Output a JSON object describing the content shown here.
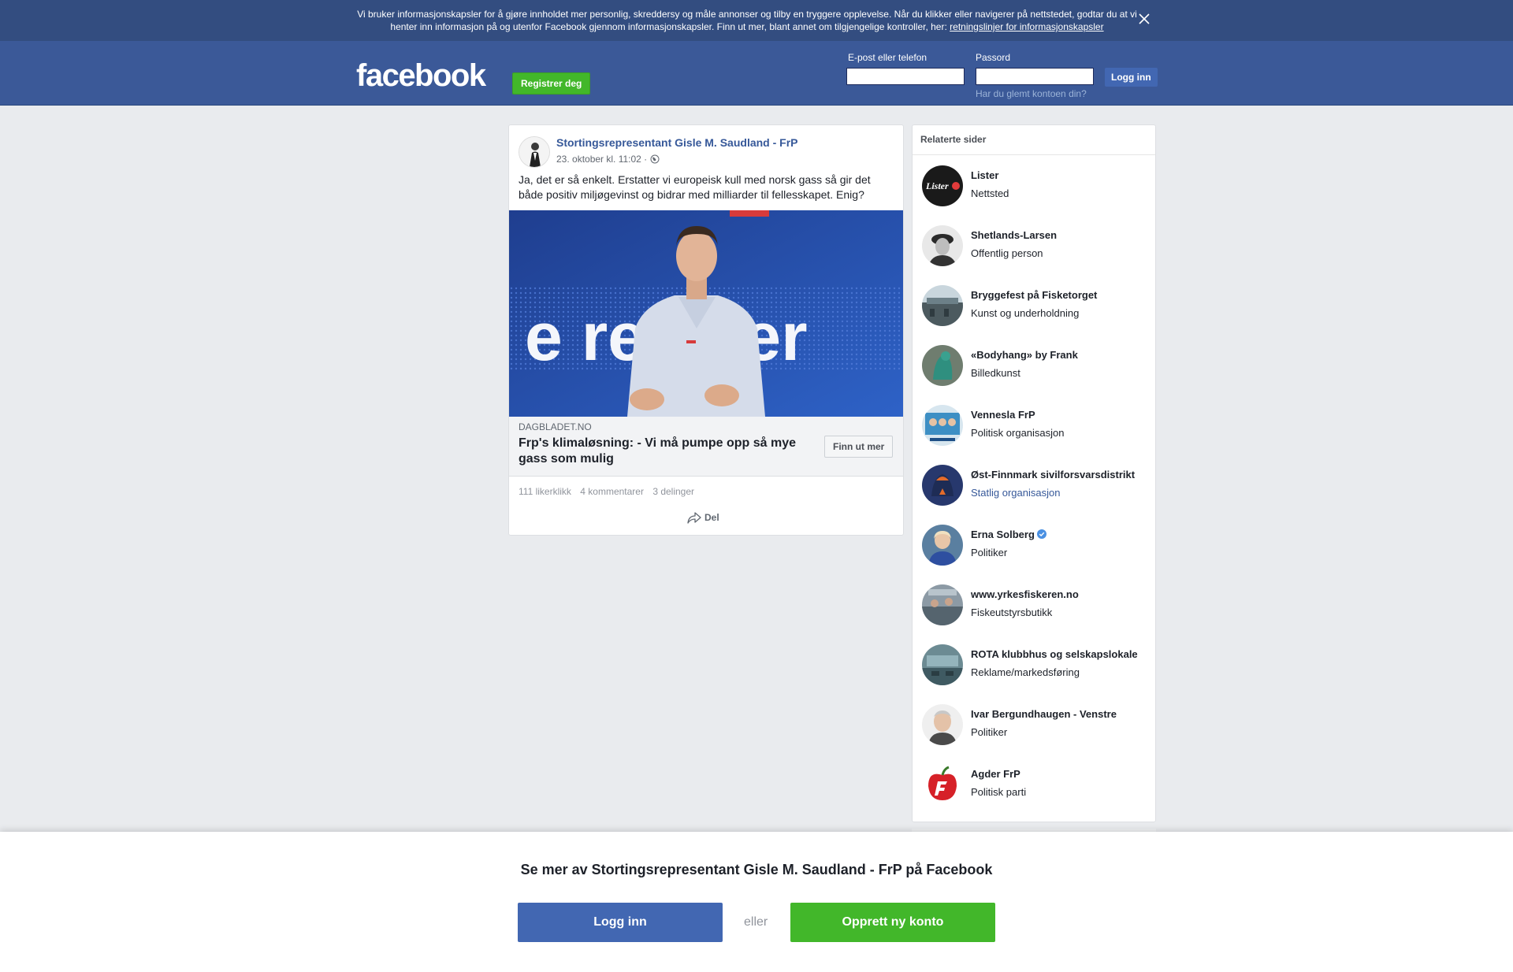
{
  "cookie_banner": {
    "text": "Vi bruker informasjonskapsler for å gjøre innholdet mer personlig, skreddersy og måle annonser og tilby en tryggere opplevelse. Når du klikker eller navigerer på nettstedet, godtar du at vi henter inn informasjon på og utenfor Facebook gjennom informasjonskapsler. Finn ut mer, blant annet om tilgjengelige kontroller, her: ",
    "link": "retningslinjer for informasjonskapsler",
    "close_icon": "close-icon"
  },
  "header": {
    "logo": "facebook",
    "register_label": "Registrer deg",
    "email_label": "E-post eller telefon",
    "password_label": "Passord",
    "login_label": "Logg inn",
    "forgot": "Har du glemt kontoen din?"
  },
  "post": {
    "author": "Stortingsrepresentant Gisle M. Saudland - FrP",
    "date": "23. oktober kl. 11:02 ·",
    "text": "Ja, det er så enkelt. Erstatter vi europeisk kull med norsk gass så gir det både positiv miljøgevinst og bidrar med milliarder til fellesskapet. Enig?",
    "image_text": "e re hver",
    "link_domain": "DAGBLADET.NO",
    "link_title": "Frp's klimaløsning: - Vi må pumpe opp så mye gass som mulig",
    "link_button": "Finn ut mer",
    "likes": "111 likerklikk",
    "comments": "4 kommentarer",
    "shares": "3 delinger",
    "share_label": "Del"
  },
  "related": {
    "title": "Relaterte sider",
    "items": [
      {
        "name": "Lister",
        "category": "Nettsted",
        "avatar_text": "Lister"
      },
      {
        "name": "Shetlands-Larsen",
        "category": "Offentlig person"
      },
      {
        "name": "Bryggefest på Fisketorget",
        "category": "Kunst og underholdning"
      },
      {
        "name": "«Bodyhang» by Frank",
        "category": "Billedkunst"
      },
      {
        "name": "Vennesla FrP",
        "category": "Politisk organisasjon"
      },
      {
        "name": "Øst-Finnmark sivilforsvarsdistrikt",
        "category": "Statlig organisasjon"
      },
      {
        "name": "Erna Solberg",
        "category": "Politiker"
      },
      {
        "name": "www.yrkesfiskeren.no",
        "category": "Fiskeutstyrsbutikk"
      },
      {
        "name": "ROTA klubbhus og selskapslokale",
        "category": "Reklame/markedsføring"
      },
      {
        "name": "Ivar Bergundhaugen - Venstre",
        "category": "Politiker"
      },
      {
        "name": "Agder FrP",
        "category": "Politisk parti"
      }
    ]
  },
  "bottom": {
    "title": "Se mer av Stortingsrepresentant Gisle M. Saudland - FrP på Facebook",
    "login_label": "Logg inn",
    "or": "eller",
    "create_label": "Opprett ny konto"
  },
  "colors": {
    "brand": "#3b5998",
    "green": "#42b72a",
    "link": "#365899"
  }
}
